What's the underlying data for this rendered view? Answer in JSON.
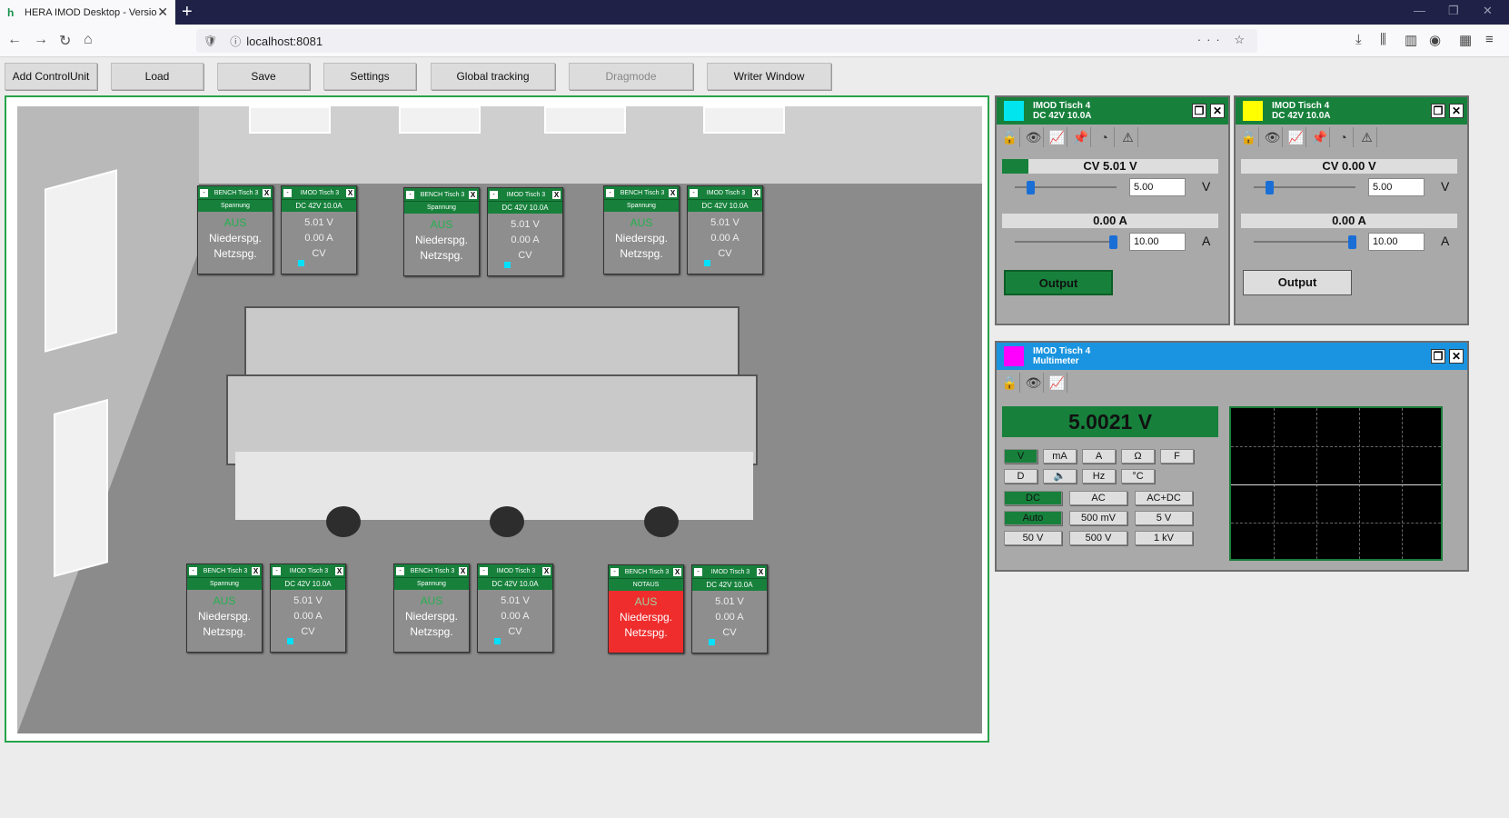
{
  "browser": {
    "tab_title": "HERA IMOD Desktop - Version",
    "url": "localhost:8081"
  },
  "toolbar": {
    "add_control_unit": "Add ControlUnit",
    "load": "Load",
    "save": "Save",
    "settings": "Settings",
    "global_tracking": "Global tracking",
    "dragmode": "Dragmode",
    "writer_window": "Writer Window"
  },
  "scene_widgets": [
    {
      "type": "bench",
      "title": "BENCH Tisch 3",
      "sub": "Spannung",
      "l1": "AUS",
      "l2": "Niederspg.",
      "l3": "Netzspg.",
      "alarm": false
    },
    {
      "type": "imod",
      "title": "IMOD Tisch 3",
      "sub": "DC 42V 10.0A",
      "l1": "5.01 V",
      "l2": "0.00 A",
      "l3": "CV"
    },
    {
      "type": "bench",
      "title": "BENCH Tisch 3",
      "sub": "Spannung",
      "l1": "AUS",
      "l2": "Niederspg.",
      "l3": "Netzspg.",
      "alarm": false
    },
    {
      "type": "imod",
      "title": "IMOD Tisch 3",
      "sub": "DC 42V 10.0A",
      "l1": "5.01 V",
      "l2": "0.00 A",
      "l3": "CV"
    },
    {
      "type": "bench",
      "title": "BENCH Tisch 3",
      "sub": "Spannung",
      "l1": "AUS",
      "l2": "Niederspg.",
      "l3": "Netzspg.",
      "alarm": false
    },
    {
      "type": "imod",
      "title": "IMOD Tisch 3",
      "sub": "DC 42V 10.0A",
      "l1": "5.01 V",
      "l2": "0.00 A",
      "l3": "CV"
    },
    {
      "type": "bench",
      "title": "BENCH Tisch 3",
      "sub": "Spannung",
      "l1": "AUS",
      "l2": "Niederspg.",
      "l3": "Netzspg.",
      "alarm": false
    },
    {
      "type": "imod",
      "title": "IMOD Tisch 3",
      "sub": "DC 42V 10.0A",
      "l1": "5.01 V",
      "l2": "0.00 A",
      "l3": "CV"
    },
    {
      "type": "bench",
      "title": "BENCH Tisch 3",
      "sub": "Spannung",
      "l1": "AUS",
      "l2": "Niederspg.",
      "l3": "Netzspg.",
      "alarm": false
    },
    {
      "type": "imod",
      "title": "IMOD Tisch 3",
      "sub": "DC 42V 10.0A",
      "l1": "5.01 V",
      "l2": "0.00 A",
      "l3": "CV"
    },
    {
      "type": "bench",
      "title": "BENCH Tisch 3",
      "sub": "NOTAUS",
      "l1": "AUS",
      "l2": "Niederspg.",
      "l3": "Netzspg.",
      "alarm": true
    },
    {
      "type": "imod",
      "title": "IMOD Tisch 3",
      "sub": "DC 42V 10.0A",
      "l1": "5.01 V",
      "l2": "0.00 A",
      "l3": "CV"
    }
  ],
  "psu1": {
    "title1": "IMOD Tisch 4",
    "title2": "DC 42V 10.0A",
    "color": "#00e5ee",
    "voltage_bar": "CV 5.01 V",
    "voltage_set": "5.00",
    "voltage_unit": "V",
    "current_bar": "0.00 A",
    "current_set": "10.00",
    "current_unit": "A",
    "output": "Output",
    "output_on": true
  },
  "psu2": {
    "title1": "IMOD Tisch 4",
    "title2": "DC 42V 10.0A",
    "color": "#ffff00",
    "voltage_bar": "CV 0.00 V",
    "voltage_set": "5.00",
    "voltage_unit": "V",
    "current_bar": "0.00 A",
    "current_set": "10.00",
    "current_unit": "A",
    "output": "Output",
    "output_on": false
  },
  "mm": {
    "title1": "IMOD Tisch 4",
    "title2": "Multimeter",
    "color": "#ff00ff",
    "reading": "5.0021 V",
    "modes": [
      "V",
      "mA",
      "A",
      "Ω",
      "F",
      "D",
      "🔈",
      "Hz",
      "°C"
    ],
    "coupling": [
      "DC",
      "AC",
      "AC+DC"
    ],
    "ranges": [
      "Auto",
      "500 mV",
      "5 V",
      "50 V",
      "500 V",
      "1 kV"
    ]
  }
}
